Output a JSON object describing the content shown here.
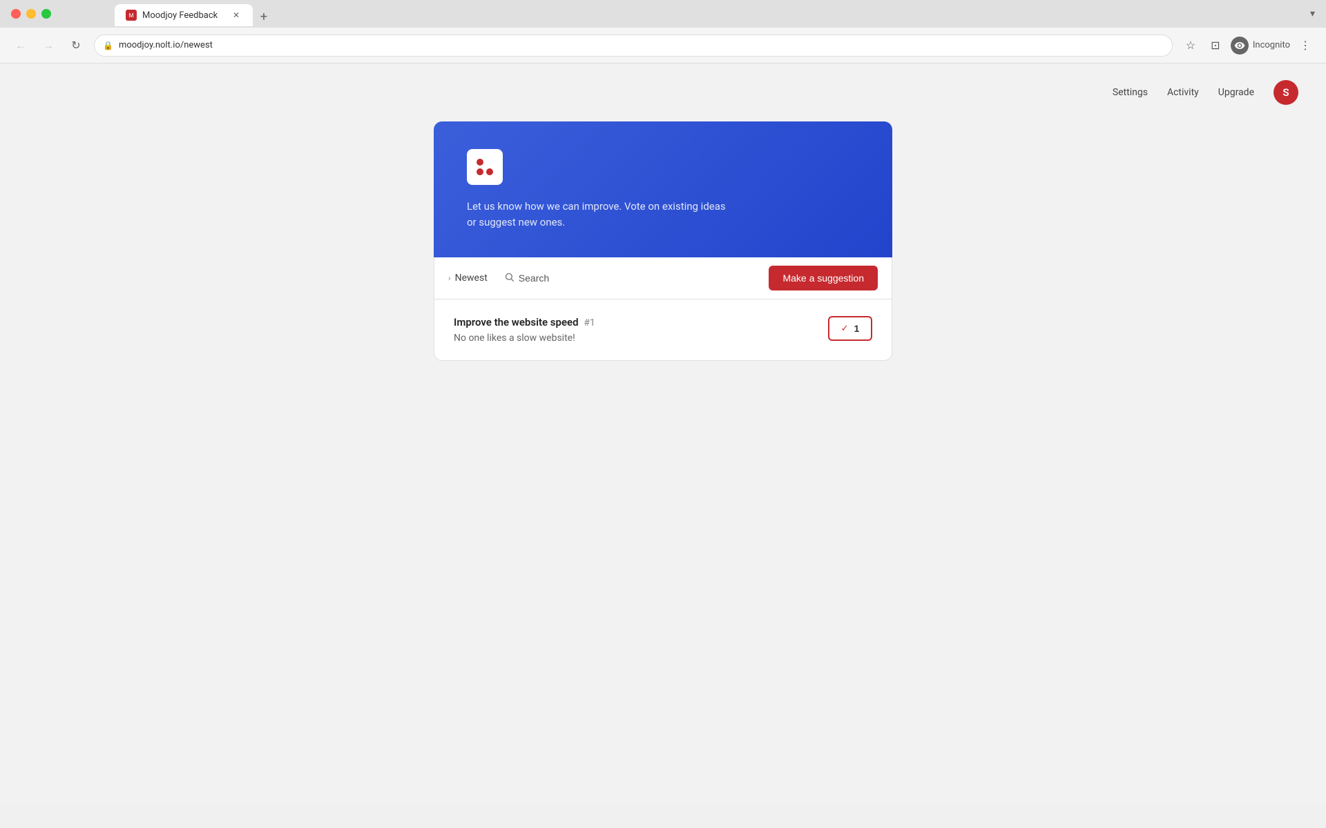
{
  "browser": {
    "tab_title": "Moodjoy Feedback",
    "tab_icon": "M",
    "url": "moodjoy.nolt.io/newest",
    "new_tab_label": "+",
    "nav": {
      "back_label": "←",
      "forward_label": "→",
      "reload_label": "↻"
    },
    "actions": {
      "bookmark_label": "☆",
      "split_label": "⊡",
      "incognito_label": "Incognito",
      "menu_label": "⋮"
    }
  },
  "topnav": {
    "settings_label": "Settings",
    "activity_label": "Activity",
    "upgrade_label": "Upgrade",
    "avatar_label": "S"
  },
  "hero": {
    "brand_icon": "moodjoy",
    "description": "Let us know how we can improve. Vote on existing ideas or suggest new ones."
  },
  "toolbar": {
    "sort_label": "Newest",
    "search_label": "Search",
    "make_suggestion_label": "Make a suggestion"
  },
  "suggestions": [
    {
      "id": "#1",
      "title": "Improve the website speed",
      "description": "No one likes a slow website!",
      "votes": 1
    }
  ],
  "colors": {
    "accent_red": "#c62a2f",
    "hero_blue": "#3b5fdb"
  }
}
